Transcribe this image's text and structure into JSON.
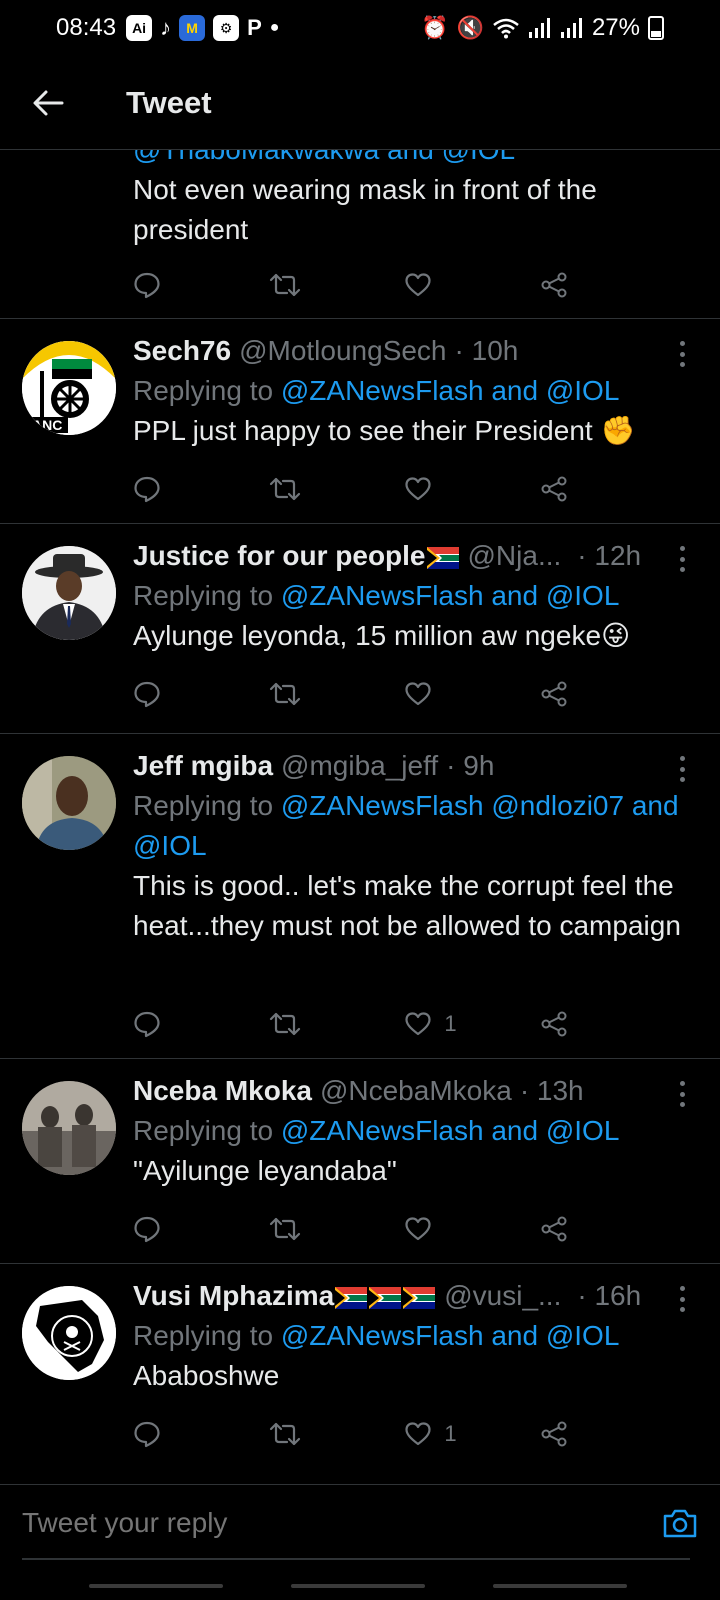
{
  "status_bar": {
    "time": "08:43",
    "battery": "27%",
    "app_icons": [
      "ai-icon",
      "tiktok-icon",
      "hemovie-icon",
      "shield-icon",
      "p-icon"
    ],
    "ai_label": "Ai"
  },
  "header": {
    "title": "Tweet"
  },
  "partial_tweet": {
    "reply_line": "@ThaboMakwakwa and @IOL",
    "text": "Not even wearing mask in front of the president"
  },
  "tweets": [
    {
      "name": "Sech76",
      "handle": "@MotloungSech",
      "time": "· 10h",
      "reply_prefix": "Replying to",
      "reply_mentions": "@ZANewsFlash and @IOL",
      "text": "PPL just happy to see their President ✊",
      "likes": ""
    },
    {
      "name": "Justice for our people",
      "handle": "@Nja...",
      "time": "· 12h",
      "reply_prefix": "Replying to",
      "reply_mentions": "@ZANewsFlash and @IOL",
      "text": "Aylunge leyonda, 15 million aw ngeke😜",
      "likes": ""
    },
    {
      "name": "Jeff mgiba",
      "handle": "@mgiba_jeff",
      "time": "· 9h",
      "reply_prefix": "Replying to",
      "reply_mentions": "@ZANewsFlash @ndlozi07 and @IOL",
      "text": "This is good.. let's make the corrupt feel the heat...they must not be allowed to campaign",
      "likes": "1"
    },
    {
      "name": "Nceba Mkoka",
      "handle": "@NcebaMkoka",
      "time": "· 13h",
      "reply_prefix": "Replying to",
      "reply_mentions": "@ZANewsFlash and @IOL",
      "text": "\"Ayilunge leyandaba\"",
      "likes": ""
    },
    {
      "name": "Vusi Mphazima",
      "handle": "@vusi_...",
      "time": "· 16h",
      "reply_prefix": "Replying to",
      "reply_mentions": "@ZANewsFlash and @IOL",
      "text": "Ababoshwe",
      "likes": "1"
    }
  ],
  "reply_bar": {
    "placeholder": "Tweet your reply"
  },
  "colors": {
    "accent": "#1d9bf0",
    "muted": "#71767b",
    "text": "#e7e9ea",
    "divider": "#2f3336"
  }
}
